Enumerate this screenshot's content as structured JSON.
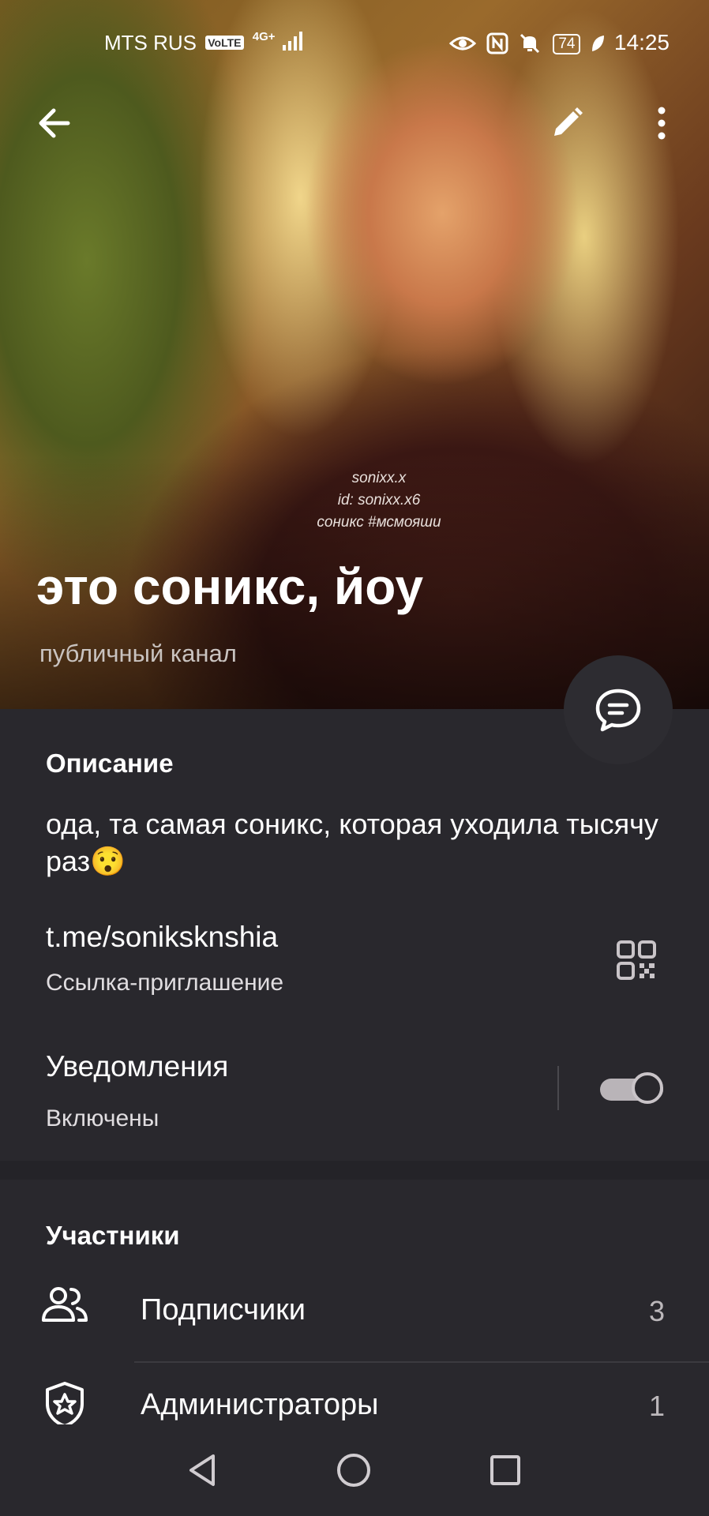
{
  "status_bar": {
    "carrier": "MTS RUS",
    "volte": "VoLTE",
    "network": "4G+",
    "battery": "74",
    "time": "14:25"
  },
  "header": {
    "back_icon": "arrow-left-icon",
    "edit_icon": "pencil-icon",
    "more_icon": "more-vertical-icon"
  },
  "profile": {
    "shirt_lines": [
      "sonixx.x",
      "id: sonixx.x6",
      "соникс #мсмояши"
    ],
    "title": "это соникс, йоу",
    "subtitle": "публичный канал",
    "chat_button_icon": "chat-bubble-icon"
  },
  "info": {
    "description_heading": "Описание",
    "description_text": "ода, та самая соникс, которая уходила тысячу раз😯",
    "link": "t.me/sonikskn​shia",
    "link_sub": "Ссылка-приглашение",
    "qr_icon": "qr-code-icon",
    "notifications_label": "Уведомления",
    "notifications_status": "Включены",
    "notifications_enabled": true
  },
  "members": {
    "heading": "Участники",
    "rows": [
      {
        "label": "Подписчики",
        "count": "3",
        "icon": "users-icon"
      },
      {
        "label": "Администраторы",
        "count": "1",
        "icon": "shield-star-icon"
      }
    ]
  },
  "nav": {
    "back": "triangle-back-icon",
    "home": "circle-home-icon",
    "recents": "square-recents-icon"
  }
}
